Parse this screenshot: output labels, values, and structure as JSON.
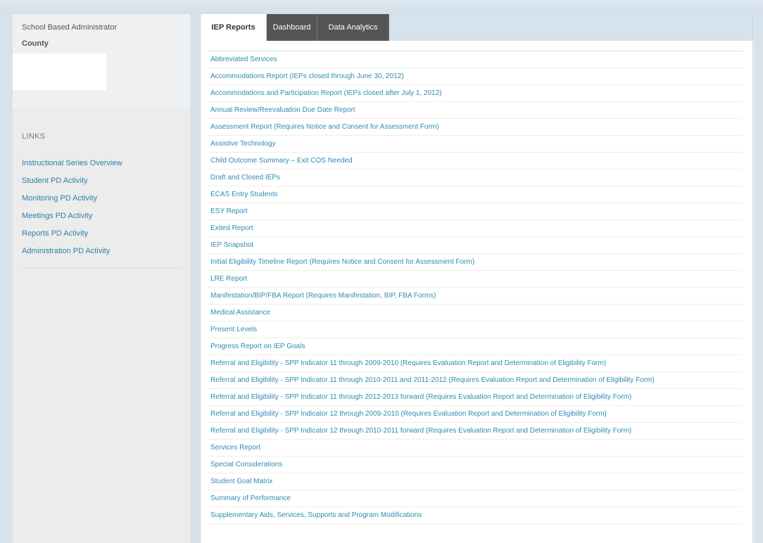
{
  "sidebar": {
    "role": "School Based Administrator",
    "county": "County",
    "links_title": "LINKS",
    "links": [
      "Instructional Series Overview",
      "Student PD Activity",
      "Monitoring PD Activity",
      "Meetings PD Activity",
      "Reports PD Activity",
      "Administration PD Activity"
    ]
  },
  "tabs": {
    "iep_reports": "IEP Reports",
    "dashboard": "Dashboard",
    "data_analytics": "Data Analytics"
  },
  "reports": [
    "Abbreviated Services",
    "Accommodations Report (IEPs closed through June 30, 2012)",
    "Accommodations and Participation Report (IEPs closed after July 1, 2012)",
    "Annual Review/Reevaluation Due Date Report",
    "Assessment Report (Requires Notice and Consent for Assessment Form)",
    "Assistive Technology",
    "Child Outcome Summary – Exit COS Needed",
    "Draft and Closed IEPs",
    "ECAS Entry Students",
    "ESY Report",
    "Exited Report",
    "IEP Snapshot",
    "Initial Eligibility Timeline Report (Requires Notice and Consent for Assessment Form)",
    "LRE Report",
    "Manifestation/BIP/FBA Report (Requires Manifestation, BIP, FBA Forms)",
    "Medical Assistance",
    "Present Levels",
    "Progress Report on IEP Goals",
    "Referral and Eligibility - SPP Indicator 11 through 2009-2010 (Requires Evaluation Report and Determination of Eligibility Form)",
    "Referral and Eligibility - SPP Indicator 11 through 2010-2011 and 2011-2012 (Requires Evaluation Report and Determination of Eligibility Form)",
    "Referral and Eligibility - SPP Indicator 11 through 2012-2013 forward (Requires Evaluation Report and Determination of Eligibility Form)",
    "Referral and Eligibility - SPP Indicator 12 through 2009-2010 (Requires Evaluation Report and Determination of Eligibility Form)",
    "Referral and Eligibility - SPP Indicator 12 through 2010-2011 forward (Requires Evaluation Report and Determination of Eligibility Form)",
    "Services Report",
    "Special Considerations",
    "Student Goal Matrix",
    "Summary of Performance",
    "Supplementary Aids, Services, Supports and Program Modifications"
  ]
}
